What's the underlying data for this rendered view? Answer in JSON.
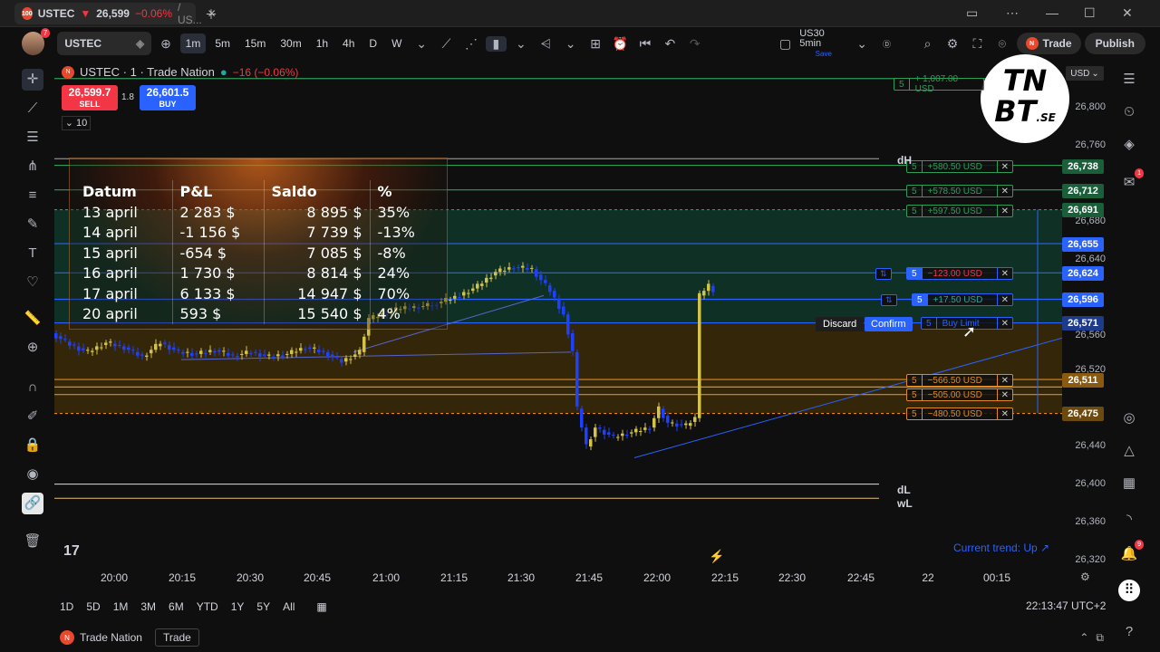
{
  "tab": {
    "symbol": "USTEC",
    "price": "26,599",
    "change": "−0.06%",
    "suffix": "/ US..."
  },
  "toolbar": {
    "symbol": "USTEC",
    "avatar_badge": "7",
    "intervals": [
      "1m",
      "5m",
      "15m",
      "30m",
      "1h",
      "4h",
      "D",
      "W"
    ],
    "active_interval": "1m",
    "layout_name": "US30 5min",
    "layout_sub": "Save",
    "trade_label": "Trade",
    "publish_label": "Publish"
  },
  "legend": {
    "title": "USTEC · 1 · Trade Nation",
    "change": "−16 (−0.06%)",
    "sell_price": "26,599.7",
    "sell_label": "SELL",
    "buy_price": "26,601.5",
    "buy_label": "BUY",
    "spread": "1.8",
    "quantity": "10"
  },
  "pnl_table": {
    "headers": [
      "Datum",
      "P&L",
      "Saldo",
      "%"
    ],
    "rows": [
      {
        "date": "13 april",
        "pnl": "2 283 $",
        "saldo": "8 895 $",
        "pct": "35%",
        "neg": false
      },
      {
        "date": "14 april",
        "pnl": "-1 156 $",
        "saldo": "7 739 $",
        "pct": "-13%",
        "neg": true
      },
      {
        "date": "15 april",
        "pnl": "-654 $",
        "saldo": "7 085 $",
        "pct": "-8%",
        "neg": true
      },
      {
        "date": "16 april",
        "pnl": "1 730 $",
        "saldo": "8 814 $",
        "pct": "24%",
        "neg": false
      },
      {
        "date": "17 april",
        "pnl": "6 133 $",
        "saldo": "14 947 $",
        "pct": "70%",
        "neg": false
      },
      {
        "date": "20 april",
        "pnl": "593 $",
        "saldo": "15 540 $",
        "pct": "4%",
        "neg": false
      }
    ]
  },
  "orders": [
    {
      "qty": "5",
      "value": "+ 1,007.00 USD",
      "kind": "tp"
    },
    {
      "qty": "5",
      "value": "+580.50 USD",
      "kind": "tp"
    },
    {
      "qty": "5",
      "value": "+578.50 USD",
      "kind": "tp"
    },
    {
      "qty": "5",
      "value": "+597.50 USD",
      "kind": "tp"
    },
    {
      "qty": "5",
      "value": "−123.00 USD",
      "kind": "pos"
    },
    {
      "qty": "5",
      "value": "+17.50 USD",
      "kind": "pos"
    },
    {
      "qty": "5",
      "value": "Buy Limit",
      "kind": "limit"
    },
    {
      "qty": "5",
      "value": "−566.50 USD",
      "kind": "sl"
    },
    {
      "qty": "5",
      "value": "−505.00 USD",
      "kind": "sl"
    },
    {
      "qty": "5",
      "value": "−480.50 USD",
      "kind": "sl"
    }
  ],
  "discard_label": "Discard",
  "confirm_label": "Confirm",
  "currency": "USD",
  "price_labels": [
    "26,800",
    "26,760",
    "26,680",
    "26,640",
    "26,560",
    "26,520",
    "26,440",
    "26,400",
    "26,360",
    "26,320"
  ],
  "price_tags": [
    {
      "text": "26,738",
      "color": "#1a5e3a"
    },
    {
      "text": "26,712",
      "color": "#1a5e3a"
    },
    {
      "text": "26,691",
      "color": "#1a5e3a"
    },
    {
      "text": "26,655",
      "color": "#2962ff"
    },
    {
      "text": "26,624",
      "color": "#2962ff"
    },
    {
      "text": "26,596",
      "color": "#2962ff"
    },
    {
      "text": "26,571",
      "color": "#1e3a8a"
    },
    {
      "text": "26,511",
      "color": "#8a5a10"
    },
    {
      "text": "26,475",
      "color": "#6b4a10"
    }
  ],
  "time_labels": [
    "20:00",
    "20:15",
    "20:30",
    "20:45",
    "21:00",
    "21:15",
    "21:30",
    "21:45",
    "22:00",
    "22:15",
    "22:30",
    "22:45",
    "22",
    "00:15"
  ],
  "level_labels": {
    "dh": "dH",
    "dl": "dL",
    "wl": "wL"
  },
  "trend_label": "Current trend: Up ↗",
  "ranges": [
    "1D",
    "5D",
    "1M",
    "3M",
    "6M",
    "YTD",
    "1Y",
    "5Y",
    "All"
  ],
  "clock": "22:13:47 UTC+2",
  "footer": {
    "broker": "Trade Nation",
    "trade": "Trade"
  },
  "watermark": {
    "line1": "TN",
    "line2": "BT",
    "se": ".SE"
  },
  "badges": {
    "alerts": "1",
    "notifications": "9"
  },
  "colors": {
    "bg": "#0f0f0f",
    "up": "#26a69a",
    "down": "#f23645",
    "bull_candle": "#d4c24a",
    "bear_candle": "#1e40ff",
    "accent": "#2962ff"
  }
}
